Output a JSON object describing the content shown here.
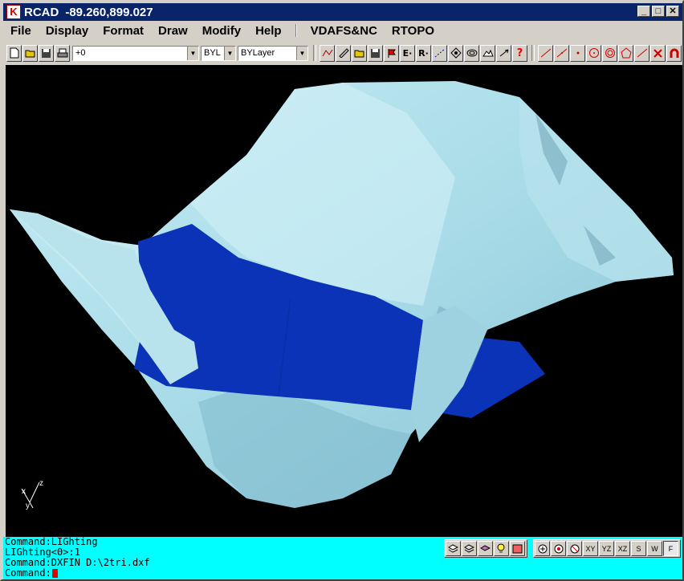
{
  "window": {
    "app_name": "RCAD",
    "coords": "-89.260,899.027",
    "app_icon": "rcad-logo-icon",
    "minimize_glyph": "_",
    "maximize_glyph": "□",
    "close_glyph": "✕"
  },
  "menu": {
    "items": [
      "File",
      "Display",
      "Format",
      "Draw",
      "Modify",
      "Help"
    ],
    "extra_items": [
      "VDAFS&NC",
      "RTOPO"
    ]
  },
  "toolbar": {
    "layer_combo": "+0",
    "color_combo": "BYL",
    "linetype_combo": "BYLayer",
    "file_buttons": [
      "new-file-icon",
      "open-folder-icon",
      "save-disk-icon",
      "print-icon"
    ],
    "tool_buttons": [
      "polyline-icon",
      "edit-icon",
      "open-icon",
      "save-icon",
      "flag-icon",
      "E-icon",
      "R-icon",
      "dotted-line-icon",
      "node-icon",
      "surface-icon",
      "terrain-icon",
      "arrow-icon",
      "help-icon"
    ],
    "draw_buttons": [
      "line-icon",
      "line2-icon",
      "point-icon",
      "circle-icon",
      "circle-ring-icon",
      "polygon-icon",
      "arc-icon",
      "delete-icon",
      "magnet-icon"
    ]
  },
  "view_toolbar": {
    "layer_buttons": [
      "layers-icon",
      "layers2-icon",
      "layer-prop-icon",
      "light-bulb-icon",
      "hatch-icon"
    ],
    "zoom_buttons": [
      "zoom-icon",
      "zoom-window-icon",
      "zoom-extents-icon"
    ],
    "views": [
      "XY",
      "YZ",
      "XZ",
      "S",
      "W",
      "F"
    ]
  },
  "axis_labels": {
    "x": "x",
    "y": "y",
    "z": "z"
  },
  "command": {
    "lines": [
      "Command:LIGhting",
      "LIGhting<0>:1",
      "Command:DXFIN D:\\2tri.dxf"
    ],
    "prompt": "Command:"
  },
  "colors": {
    "viewport_bg": "#000000",
    "terrain": "#a9dce8",
    "terrain_shade": "#7fb9cc",
    "plane": "#0b33b8",
    "command_bg": "#00ffff",
    "titlebar": "#0a246a",
    "cursor": "#e00000"
  }
}
